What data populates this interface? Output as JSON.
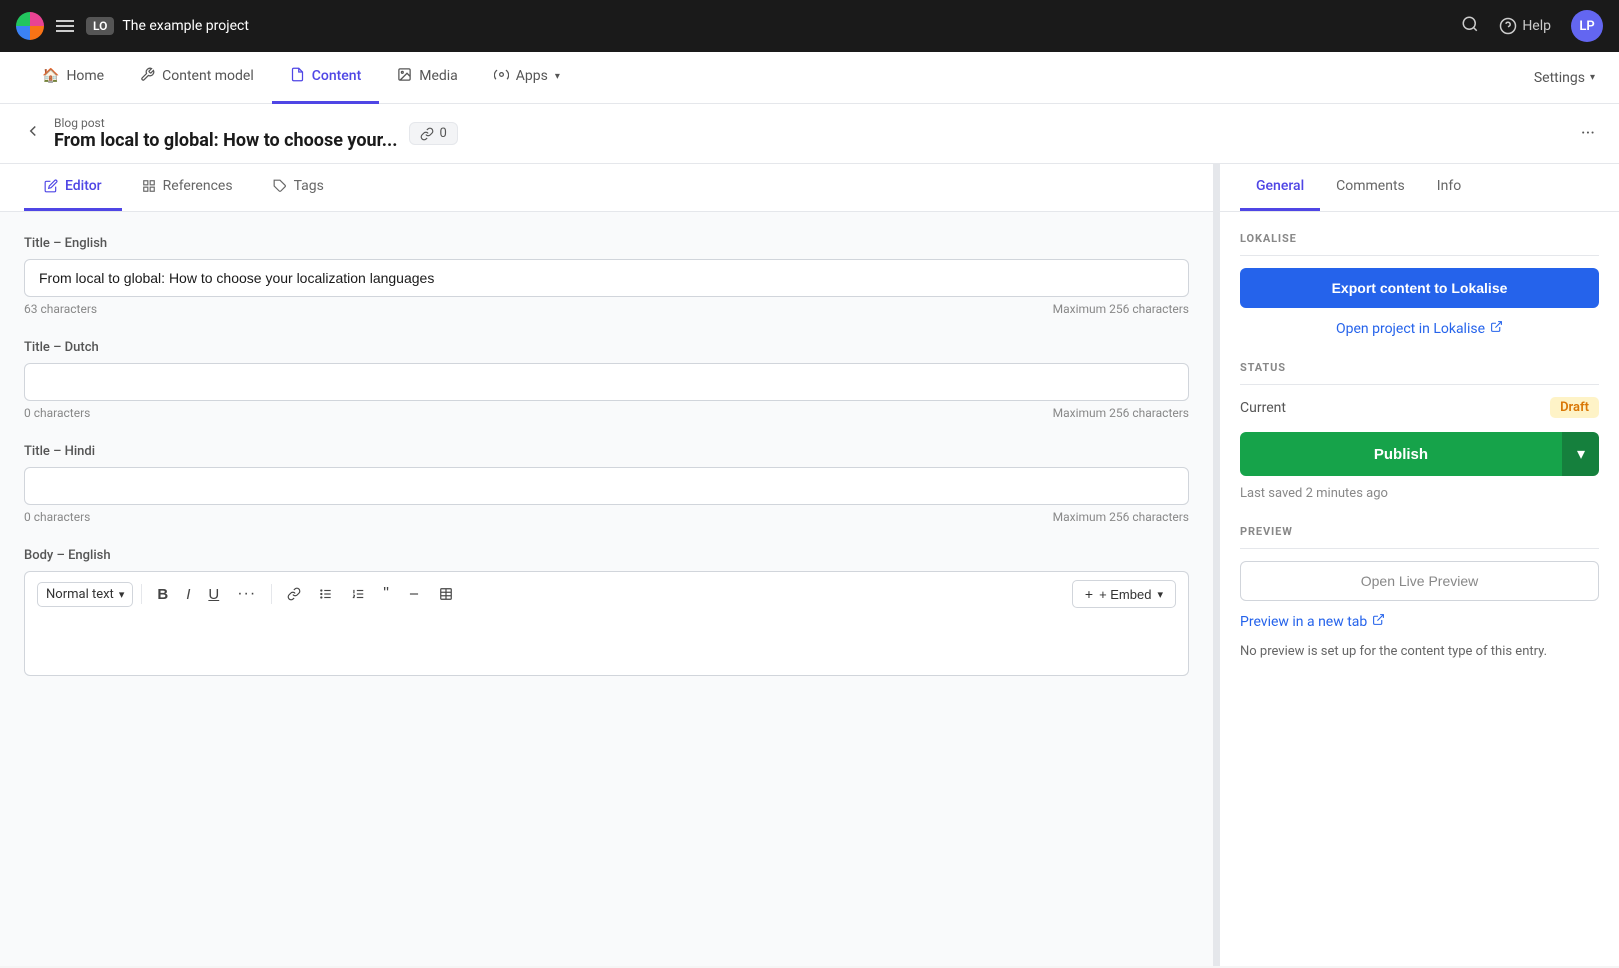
{
  "topbar": {
    "project_badge": "LO",
    "project_name": "The example project",
    "help_label": "Help",
    "avatar_initials": "LP"
  },
  "secondnav": {
    "items": [
      {
        "id": "home",
        "label": "Home",
        "icon": "🏠",
        "active": false
      },
      {
        "id": "content-model",
        "label": "Content model",
        "icon": "🔧",
        "active": false
      },
      {
        "id": "content",
        "label": "Content",
        "icon": "📄",
        "active": true
      },
      {
        "id": "media",
        "label": "Media",
        "icon": "🖼",
        "active": false
      },
      {
        "id": "apps",
        "label": "Apps",
        "icon": "⚙️",
        "active": false
      }
    ],
    "settings_label": "Settings"
  },
  "breadcrumb": {
    "type_label": "Blog post",
    "title": "From local to global: How to choose your...",
    "link_count": "0"
  },
  "tabs": {
    "editor_label": "Editor",
    "references_label": "References",
    "tags_label": "Tags"
  },
  "fields": {
    "title_english_label": "Title – English",
    "title_english_value": "From local to global: How to choose your localization languages",
    "title_english_chars": "63 characters",
    "title_english_max": "Maximum 256 characters",
    "title_dutch_label": "Title – Dutch",
    "title_dutch_value": "",
    "title_dutch_chars": "0 characters",
    "title_dutch_max": "Maximum 256 characters",
    "title_hindi_label": "Title – Hindi",
    "title_hindi_value": "",
    "title_hindi_chars": "0 characters",
    "title_hindi_max": "Maximum 256 characters",
    "body_english_label": "Body – English",
    "normal_text_label": "Normal text",
    "embed_label": "+ Embed"
  },
  "sidebar": {
    "tabs": {
      "general_label": "General",
      "comments_label": "Comments",
      "info_label": "Info"
    },
    "lokalise": {
      "section_title": "LOKALISE",
      "export_btn_label": "Export content to Lokalise",
      "open_project_label": "Open project in Lokalise"
    },
    "status": {
      "section_title": "STATUS",
      "current_label": "Current",
      "status_badge": "Draft",
      "publish_label": "Publish",
      "last_saved": "Last saved 2 minutes ago"
    },
    "preview": {
      "section_title": "PREVIEW",
      "open_live_preview_label": "Open Live Preview",
      "preview_new_tab_label": "Preview in a new tab",
      "preview_note": "No preview is set up for the content type of this entry."
    }
  }
}
